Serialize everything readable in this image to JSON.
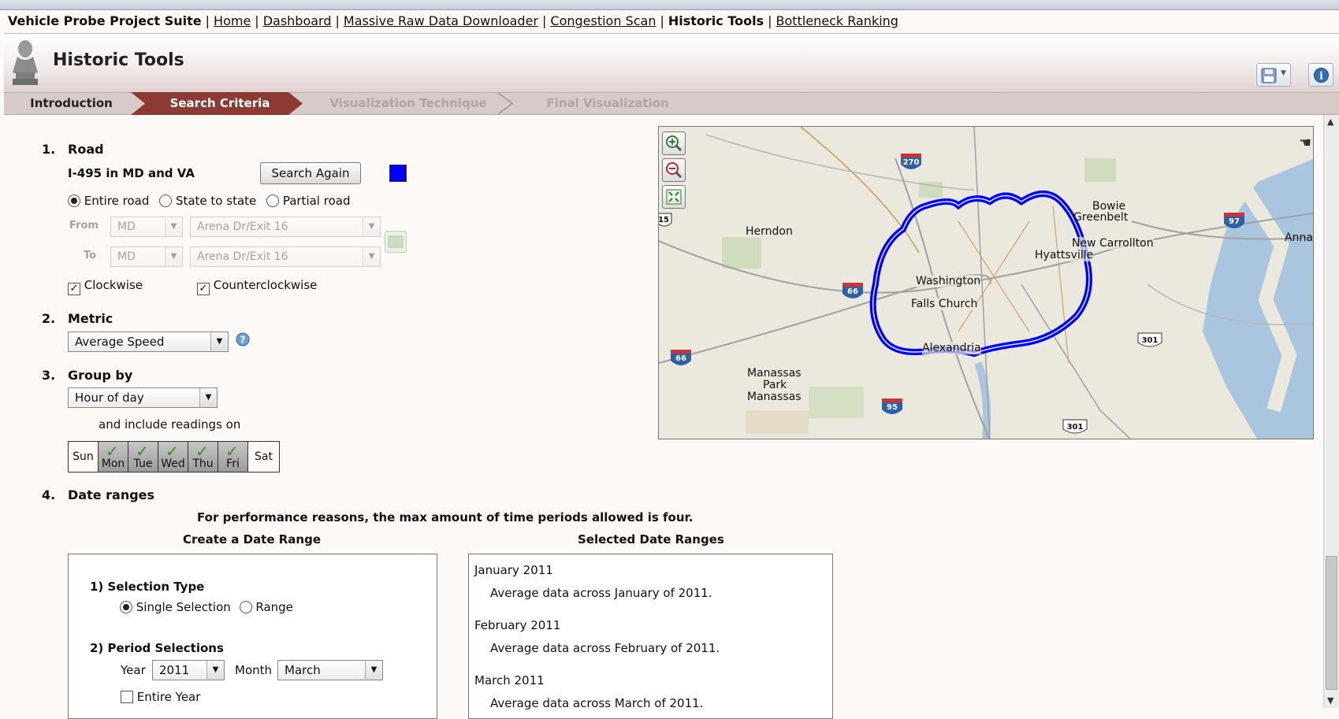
{
  "nav": {
    "brand": "Vehicle Probe Project Suite",
    "links": [
      "Home",
      "Dashboard",
      "Massive Raw Data Downloader",
      "Congestion Scan"
    ],
    "current": "Historic Tools",
    "last_link": "Bottleneck Ranking",
    "separator": "|"
  },
  "header": {
    "title": "Historic Tools",
    "save_icon": "floppy-disk-icon",
    "info_icon": "info-icon"
  },
  "steps": [
    "Introduction",
    "Search Criteria",
    "Visualization Technique",
    "Final Visualization"
  ],
  "colors": {
    "accent": "#8b3a34",
    "route": "#0000ff",
    "step_active": "#8b3a34"
  },
  "road": {
    "num": "1.",
    "label": "Road",
    "name": "I-495 in MD and VA",
    "search_again": "Search Again",
    "color_swatch": "#0000ff",
    "options": [
      "Entire road",
      "State to state",
      "Partial road"
    ],
    "selected_option": "Entire road",
    "from_label": "From",
    "to_label": "To",
    "from_state": "MD",
    "from_exit": "Arena Dr/Exit 16",
    "to_state": "MD",
    "to_exit": "Arena Dr/Exit 16",
    "clockwise": "Clockwise",
    "counterclockwise": "Counterclockwise"
  },
  "metric": {
    "num": "2.",
    "label": "Metric",
    "value": "Average Speed"
  },
  "groupby": {
    "num": "3.",
    "label": "Group by",
    "value": "Hour of day",
    "include_text": "and include readings on",
    "days": [
      "Sun",
      "Mon",
      "Tue",
      "Wed",
      "Thu",
      "Fri",
      "Sat"
    ],
    "days_selected": [
      "Mon",
      "Tue",
      "Wed",
      "Thu",
      "Fri"
    ]
  },
  "dates": {
    "num": "4.",
    "label": "Date ranges",
    "notice": "For performance reasons, the max amount of time periods allowed is four.",
    "create_title": "Create a Date Range",
    "selected_title": "Selected Date Ranges",
    "selection_type_label": "1) Selection Type",
    "selection_options": [
      "Single Selection",
      "Range"
    ],
    "period_label": "2) Period Selections",
    "year_label": "Year",
    "year": "2011",
    "month_label": "Month",
    "month": "March",
    "entire_year": "Entire Year",
    "ranges": [
      {
        "title": "January 2011",
        "desc": "Average data across January of 2011."
      },
      {
        "title": "February 2011",
        "desc": "Average data across February of 2011."
      },
      {
        "title": "March 2011",
        "desc": "Average data across March of 2011."
      }
    ]
  },
  "map": {
    "labels": [
      "Herndon",
      "Washington",
      "Falls Church",
      "Alexandria",
      "Bowie",
      "Greenbelt",
      "New Carrollton",
      "Hyattsville",
      "Anna",
      "Manassas",
      "Park",
      "Manassas"
    ],
    "shields": [
      "270",
      "97",
      "66",
      "66",
      "95",
      "301",
      "301",
      "15"
    ],
    "controls": [
      "zoom-in-icon",
      "zoom-out-icon",
      "zoom-extent-icon"
    ]
  }
}
